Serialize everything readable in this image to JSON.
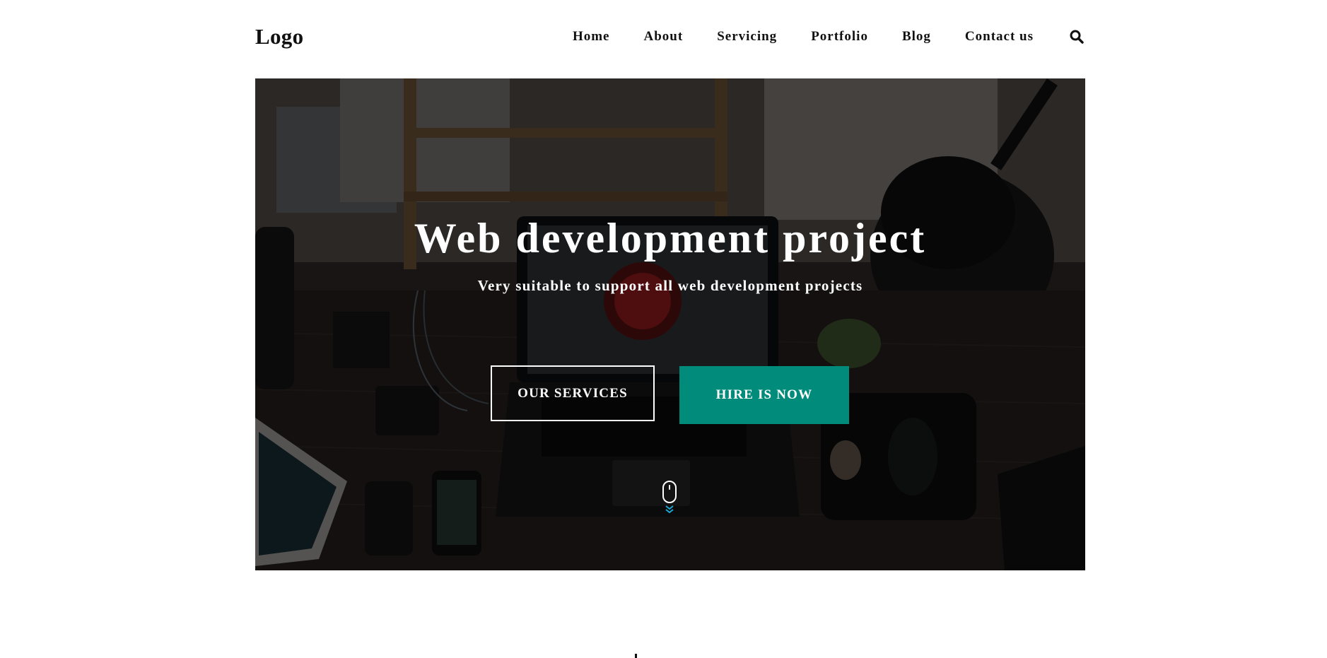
{
  "header": {
    "logo": "Logo",
    "nav": [
      "Home",
      "About",
      "Servicing",
      "Portfolio",
      "Blog",
      "Contact us"
    ],
    "search_icon": "search-icon"
  },
  "hero": {
    "title": "Web development project",
    "subtitle": "Very suitable to support all web development projects",
    "primary_button": "OUR SERVICES",
    "secondary_button": "HIRE IS NOW",
    "scroll_icon": "mouse-scroll-icon",
    "background_image": "desk-workspace-photo"
  },
  "colors": {
    "accent": "#008b7b",
    "scroll_chevron": "#1fa7d6",
    "text_dark": "#111111",
    "text_light": "#ffffff"
  }
}
